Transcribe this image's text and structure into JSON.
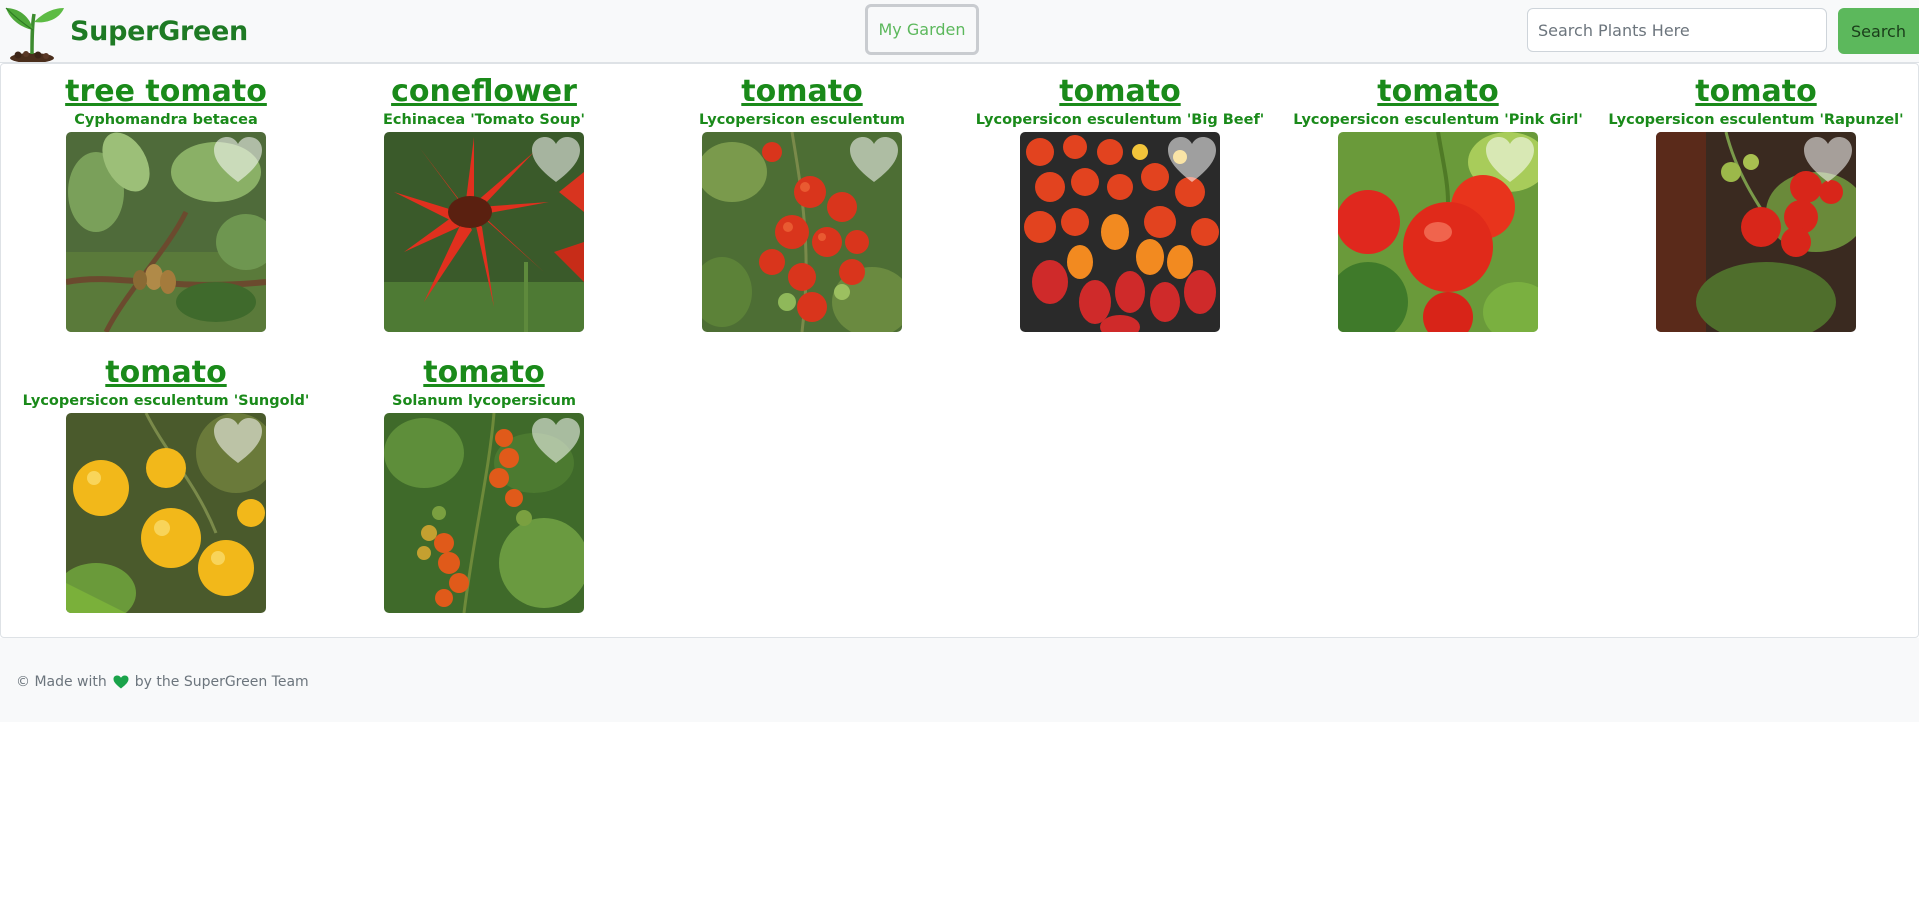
{
  "header": {
    "brand_name": "SuperGreen",
    "logo_icon": "sprout-logo-icon",
    "my_garden_label": "My Garden",
    "search_placeholder": "Search Plants Here",
    "search_value": "",
    "search_button_label": "Search"
  },
  "plants": [
    {
      "common_name": "tree tomato",
      "scientific_name": "Cyphomandra betacea",
      "image": "tree-tomato-photo"
    },
    {
      "common_name": "coneflower",
      "scientific_name": "Echinacea 'Tomato Soup'",
      "image": "coneflower-photo"
    },
    {
      "common_name": "tomato",
      "scientific_name": "Lycopersicon esculentum",
      "image": "tomato-vine-photo"
    },
    {
      "common_name": "tomato",
      "scientific_name": "Lycopersicon esculentum 'Big Beef'",
      "image": "tomato-pile-photo"
    },
    {
      "common_name": "tomato",
      "scientific_name": "Lycopersicon esculentum 'Pink Girl'",
      "image": "pink-tomato-photo"
    },
    {
      "common_name": "tomato",
      "scientific_name": "Lycopersicon esculentum 'Rapunzel'",
      "image": "cherry-tomato-photo"
    },
    {
      "common_name": "tomato",
      "scientific_name": "Lycopersicon esculentum 'Sungold'",
      "image": "yellow-tomato-photo"
    },
    {
      "common_name": "tomato",
      "scientific_name": "Solanum lycopersicum",
      "image": "tomato-plant-photo"
    }
  ],
  "footer": {
    "prefix": "© Made with",
    "suffix": "by the SuperGreen Team",
    "heart_icon": "heart-icon",
    "heart_color": "#1aa34a"
  },
  "colors": {
    "brand": "#1e7a24",
    "link": "#1a8a1a",
    "accent": "#5cb85c"
  }
}
